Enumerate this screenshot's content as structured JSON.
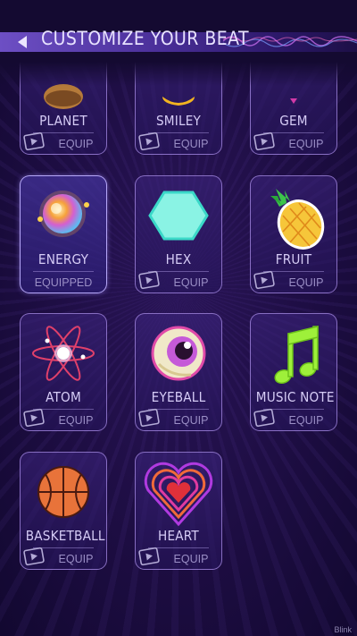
{
  "header": {
    "title": "CUSTOMIZE YOUR BEAT",
    "back_icon": "back-arrow-icon"
  },
  "items": [
    {
      "name": "PLANET",
      "status": "EQUIP",
      "locked": true,
      "icon": "planet-icon"
    },
    {
      "name": "SMILEY",
      "status": "EQUIP",
      "locked": true,
      "icon": "smiley-icon"
    },
    {
      "name": "GEM",
      "status": "EQUIP",
      "locked": true,
      "icon": "gem-icon"
    },
    {
      "name": "ENERGY",
      "status": "EQUIPPED",
      "locked": false,
      "icon": "energy-orb-icon"
    },
    {
      "name": "HEX",
      "status": "EQUIP",
      "locked": true,
      "icon": "hexagon-icon"
    },
    {
      "name": "FRUIT",
      "status": "EQUIP",
      "locked": true,
      "icon": "pineapple-icon"
    },
    {
      "name": "ATOM",
      "status": "EQUIP",
      "locked": true,
      "icon": "atom-icon"
    },
    {
      "name": "EYEBALL",
      "status": "EQUIP",
      "locked": true,
      "icon": "eyeball-icon"
    },
    {
      "name": "MUSIC NOTE",
      "status": "EQUIP",
      "locked": true,
      "icon": "music-note-icon"
    },
    {
      "name": "BASKETBALL",
      "status": "EQUIP",
      "locked": true,
      "icon": "basketball-icon"
    },
    {
      "name": "HEART",
      "status": "EQUIP",
      "locked": true,
      "icon": "heart-icon"
    }
  ],
  "watermark": "Blink"
}
